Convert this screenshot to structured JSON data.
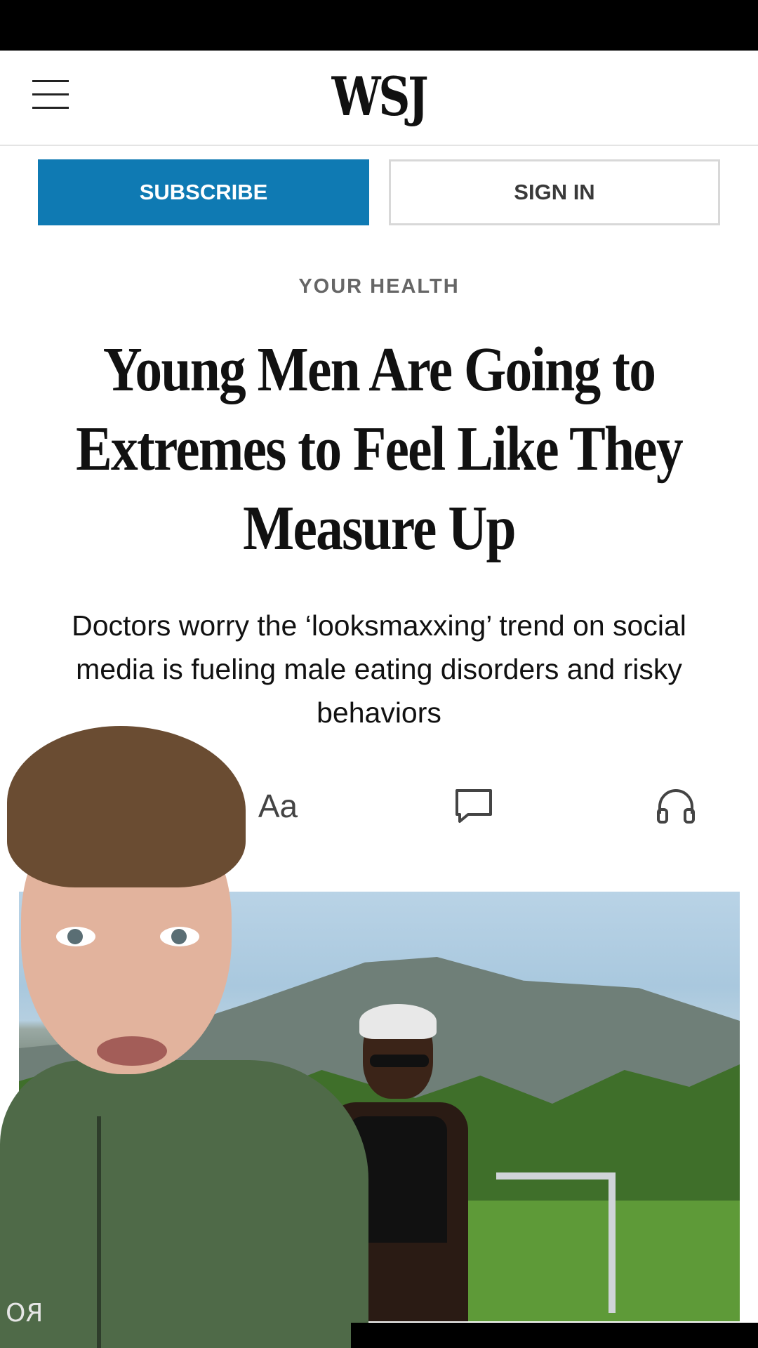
{
  "header": {
    "logo": "WSJ",
    "menu_icon": "hamburger-menu-icon"
  },
  "auth": {
    "subscribe_label": "SUBSCRIBE",
    "signin_label": "SIGN IN"
  },
  "article": {
    "section": "YOUR HEALTH",
    "headline": "Young Men Are Going to Extremes to Feel Like They Measure Up",
    "dek": "Doctors worry the ‘looksmaxxing’ trend on social media is fueling male eating disorders and risky behaviors"
  },
  "toolbar": {
    "font_size_label": "Aa",
    "comment_icon": "comment-icon",
    "listen_icon": "headphones-icon"
  },
  "overlay": {
    "jacket_logo": "RO"
  },
  "colors": {
    "subscribe_bg": "#0f7ab3",
    "text": "#111111",
    "section_label": "#666666"
  }
}
